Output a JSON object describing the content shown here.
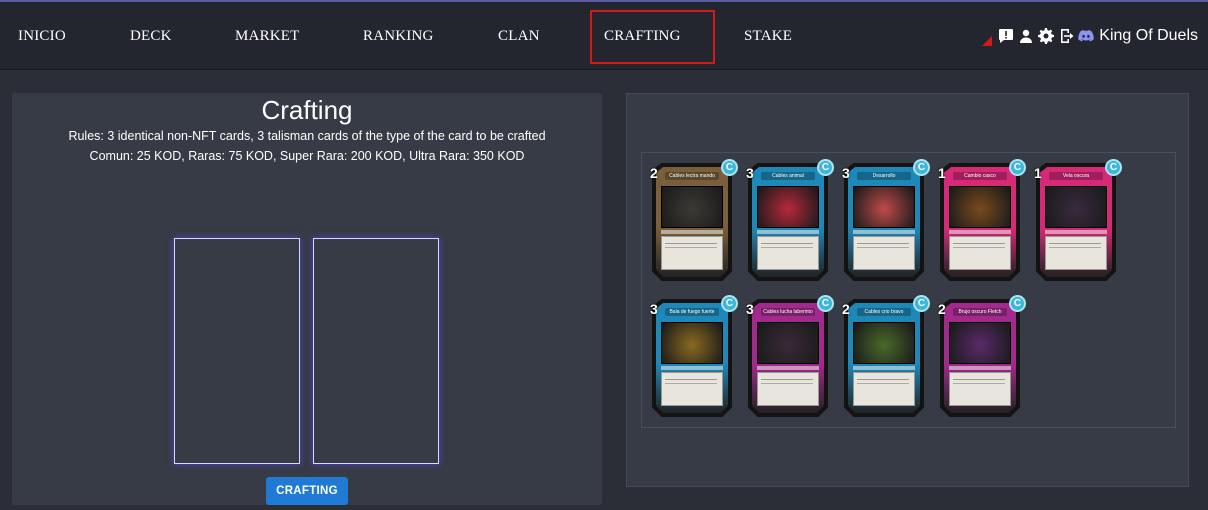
{
  "nav": {
    "items": [
      "INICIO",
      "DECK",
      "MARKET",
      "RANKING",
      "CLAN",
      "CRAFTING",
      "STAKE"
    ],
    "active": "CRAFTING",
    "brand": "King Of Duels",
    "icons": [
      "alert-triangle-icon",
      "feedback-icon",
      "user-icon",
      "gear-icon",
      "logout-icon",
      "discord-icon"
    ],
    "highlight_color": "#d11a1a"
  },
  "crafting": {
    "title": "Crafting",
    "rules": "Rules: 3 identical non-NFT cards, 3 talisman cards of the type of the card to be crafted",
    "prices": "Comun: 25 KOD, Raras: 75 KOD, Super Rara: 200 KOD, Ultra Rara: 350 KOD",
    "button_label": "CRAFTING",
    "button_color": "#1f7ad6"
  },
  "inventory": {
    "cards": [
      {
        "count": "2",
        "rarity": "C",
        "name": "Cables lectra mando",
        "theme": "#7a5f3a",
        "art": "#3d3a35"
      },
      {
        "count": "3",
        "rarity": "C",
        "name": "Cables animal",
        "theme": "#1e88b8",
        "art": "#b8283a"
      },
      {
        "count": "3",
        "rarity": "C",
        "name": "Desarrollo",
        "theme": "#1e88b8",
        "art": "#c04a4a"
      },
      {
        "count": "1",
        "rarity": "C",
        "name": "Cambio casco",
        "theme": "#d62a78",
        "art": "#7a4a1e"
      },
      {
        "count": "1",
        "rarity": "C",
        "name": "Vela oscura",
        "theme": "#d62a78",
        "art": "#3a2a40"
      },
      {
        "count": "3",
        "rarity": "C",
        "name": "Bala de fuego fuerte",
        "theme": "#1e88b8",
        "art": "#8a6a20"
      },
      {
        "count": "3",
        "rarity": "C",
        "name": "Cables lucha laberinto",
        "theme": "#a22a8c",
        "art": "#3a2a38"
      },
      {
        "count": "2",
        "rarity": "C",
        "name": "Cables crio bravo",
        "theme": "#1e88b8",
        "art": "#4a6a2a"
      },
      {
        "count": "2",
        "rarity": "C",
        "name": "Brujo oscuro Fletch",
        "theme": "#a22a8c",
        "art": "#5a2a6a"
      }
    ],
    "badge_color": "#3fb6d8"
  }
}
